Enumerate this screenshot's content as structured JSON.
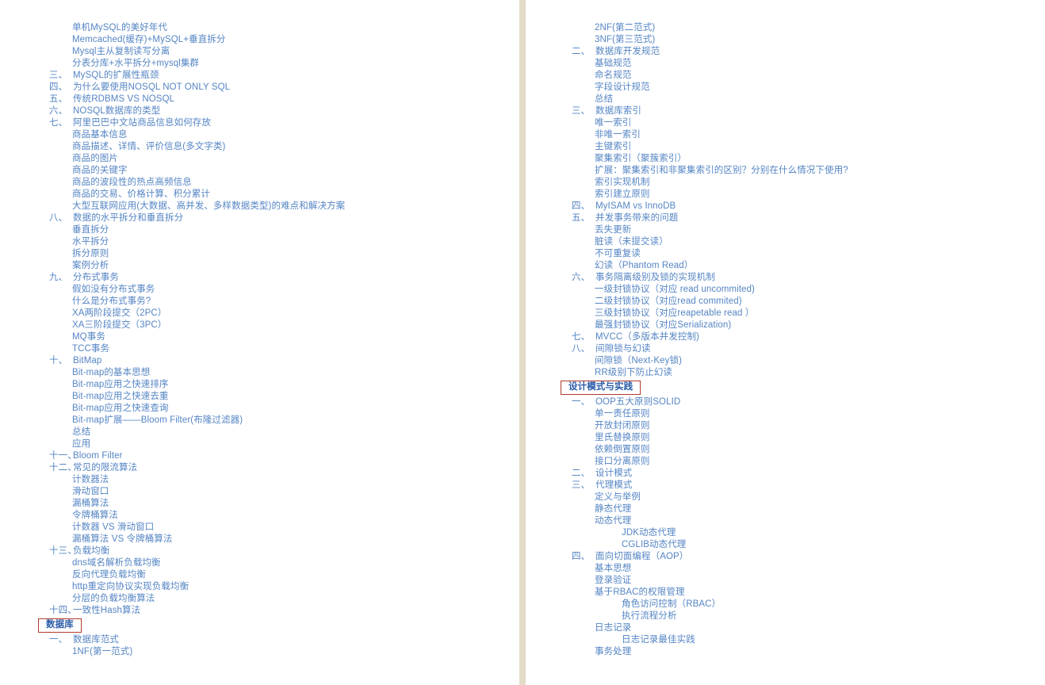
{
  "document": {
    "title": "技术知识体系目录",
    "text_color": "#5585c4",
    "section_box_border_color": "#b03a2e",
    "section_box_text_color": "#2a5ca8",
    "divider_color": "#e3dcc6"
  },
  "columns": [
    {
      "name": "left-column",
      "rows": [
        {
          "level": "sub1",
          "text": "单机MySQL的美好年代"
        },
        {
          "level": "sub1",
          "text": "Memcached(缓存)+MySQL+垂直拆分"
        },
        {
          "level": "sub1",
          "text": "Mysql主从复制读写分离"
        },
        {
          "level": "sub1",
          "text": "分表分库+水平拆分+mysql集群"
        },
        {
          "level": "num",
          "num": "三、",
          "text": "MySQL的扩展性瓶颈"
        },
        {
          "level": "num",
          "num": "四、",
          "text": "为什么要使用NOSQL NOT ONLY SQL"
        },
        {
          "level": "num",
          "num": "五、",
          "text": "传统RDBMS VS NOSQL"
        },
        {
          "level": "num",
          "num": "六、",
          "text": "NOSQL数据库的类型"
        },
        {
          "level": "num",
          "num": "七、",
          "text": "阿里巴巴中文站商品信息如何存放"
        },
        {
          "level": "sub1",
          "text": "商品基本信息"
        },
        {
          "level": "sub1",
          "text": "商品描述、详情、评价信息(多文字类)"
        },
        {
          "level": "sub1",
          "text": "商品的图片"
        },
        {
          "level": "sub1",
          "text": "商品的关键字"
        },
        {
          "level": "sub1",
          "text": "商品的波段性的热点高频信息"
        },
        {
          "level": "sub1",
          "text": "商品的交易、价格计算、积分累计"
        },
        {
          "level": "sub1",
          "text": "大型互联网应用(大数据、高并发、多样数据类型)的难点和解决方案"
        },
        {
          "level": "num",
          "num": "八、",
          "text": "数据的水平拆分和垂直拆分"
        },
        {
          "level": "sub1",
          "text": "垂直拆分"
        },
        {
          "level": "sub1",
          "text": "水平拆分"
        },
        {
          "level": "sub1",
          "text": "拆分原则"
        },
        {
          "level": "sub1",
          "text": "案例分析"
        },
        {
          "level": "num",
          "num": "九、",
          "text": "分布式事务"
        },
        {
          "level": "sub1",
          "text": "假如没有分布式事务"
        },
        {
          "level": "sub1",
          "text": "什么是分布式事务?"
        },
        {
          "level": "sub1",
          "text": "XA两阶段提交（2PC）"
        },
        {
          "level": "sub1",
          "text": "XA三阶段提交（3PC）"
        },
        {
          "level": "sub1",
          "text": "MQ事务"
        },
        {
          "level": "sub1",
          "text": "TCC事务"
        },
        {
          "level": "num",
          "num": "十、",
          "text": "BitMap"
        },
        {
          "level": "sub1",
          "text": "Bit-map的基本思想"
        },
        {
          "level": "sub1",
          "text": "Bit-map应用之快速排序"
        },
        {
          "level": "sub1",
          "text": "Bit-map应用之快速去重"
        },
        {
          "level": "sub1",
          "text": "Bit-map应用之快速查询"
        },
        {
          "level": "sub1",
          "text": "Bit-map扩展——Bloom Filter(布隆过滤器)"
        },
        {
          "level": "sub1",
          "text": "总结"
        },
        {
          "level": "sub1",
          "text": "应用"
        },
        {
          "level": "num",
          "num": "十一、",
          "text": "Bloom Filter"
        },
        {
          "level": "num",
          "num": "十二、",
          "text": "常见的限流算法"
        },
        {
          "level": "sub1",
          "text": "计数器法"
        },
        {
          "level": "sub1",
          "text": "滑动窗口"
        },
        {
          "level": "sub1",
          "text": "漏桶算法"
        },
        {
          "level": "sub1",
          "text": "令牌桶算法"
        },
        {
          "level": "sub1",
          "text": "计数器 VS 滑动窗口"
        },
        {
          "level": "sub1",
          "text": "漏桶算法 VS 令牌桶算法"
        },
        {
          "level": "num",
          "num": "十三、",
          "text": "负载均衡"
        },
        {
          "level": "sub1",
          "text": "dns域名解析负载均衡"
        },
        {
          "level": "sub1",
          "text": "反向代理负载均衡"
        },
        {
          "level": "sub1",
          "text": "http重定向协议实现负载均衡"
        },
        {
          "level": "sub1",
          "text": "分层的负载均衡算法"
        },
        {
          "level": "num",
          "num": "十四、",
          "text": "一致性Hash算法"
        },
        {
          "level": "section",
          "text": "数据库"
        },
        {
          "level": "num",
          "num": "一、",
          "text": "数据库范式"
        },
        {
          "level": "sub1",
          "text": "1NF(第一范式)"
        }
      ]
    },
    {
      "name": "right-column",
      "rows": [
        {
          "level": "sub1",
          "text": "2NF(第二范式)"
        },
        {
          "level": "sub1",
          "text": "3NF(第三范式)"
        },
        {
          "level": "num",
          "num": "二、",
          "text": "数据库开发规范"
        },
        {
          "level": "sub1",
          "text": "基础规范"
        },
        {
          "level": "sub1",
          "text": "命名规范"
        },
        {
          "level": "sub1",
          "text": "字段设计规范"
        },
        {
          "level": "sub1",
          "text": "总结"
        },
        {
          "level": "num",
          "num": "三、",
          "text": "数据库索引"
        },
        {
          "level": "sub1",
          "text": "唯一索引"
        },
        {
          "level": "sub1",
          "text": "非唯一索引"
        },
        {
          "level": "sub1",
          "text": "主键索引"
        },
        {
          "level": "sub1",
          "text": "聚集索引（聚簇索引）"
        },
        {
          "level": "sub1",
          "text": "扩展：聚集索引和非聚集索引的区别？分别在什么情况下使用?"
        },
        {
          "level": "sub1",
          "text": "索引实现机制"
        },
        {
          "level": "sub1",
          "text": "索引建立原则"
        },
        {
          "level": "num",
          "num": "四、",
          "text": "MyISAM vs InnoDB"
        },
        {
          "level": "num",
          "num": "五、",
          "text": "并发事务带来的问题"
        },
        {
          "level": "sub1",
          "text": "丢失更新"
        },
        {
          "level": "sub1",
          "text": "脏读（未提交读）"
        },
        {
          "level": "sub1",
          "text": "不可重复读"
        },
        {
          "level": "sub1",
          "text": "幻读（Phantom Read）"
        },
        {
          "level": "num",
          "num": "六、",
          "text": "事务隔离级别及锁的实现机制"
        },
        {
          "level": "sub1",
          "text": "一级封锁协议（对应 read uncommited)"
        },
        {
          "level": "sub1",
          "text": "二级封锁协议（对应read commited)"
        },
        {
          "level": "sub1",
          "text": "三级封锁协议（对应reapetable read ）"
        },
        {
          "level": "sub1",
          "text": "最强封锁协议（对应Serialization)"
        },
        {
          "level": "num",
          "num": "七、",
          "text": "MVCC（多版本并发控制)"
        },
        {
          "level": "num",
          "num": "八、",
          "text": "间隙锁与幻读"
        },
        {
          "level": "sub1",
          "text": "间隙锁（Next-Key锁)"
        },
        {
          "level": "sub1",
          "text": "RR级别下防止幻读"
        },
        {
          "level": "section",
          "text": "设计模式与实践"
        },
        {
          "level": "num",
          "num": "一、",
          "text": "OOP五大原则SOLID"
        },
        {
          "level": "sub1",
          "text": "单一责任原则"
        },
        {
          "level": "sub1",
          "text": "开放封闭原则"
        },
        {
          "level": "sub1",
          "text": "里氏替换原则"
        },
        {
          "level": "sub1",
          "text": "依赖倒置原则"
        },
        {
          "level": "sub1",
          "text": "接口分离原则"
        },
        {
          "level": "num",
          "num": "二、",
          "text": "设计模式"
        },
        {
          "level": "num",
          "num": "三、",
          "text": "代理模式"
        },
        {
          "level": "sub1",
          "text": "定义与举例"
        },
        {
          "level": "sub1",
          "text": "静态代理"
        },
        {
          "level": "sub1",
          "text": "动态代理"
        },
        {
          "level": "sub2",
          "text": "JDK动态代理"
        },
        {
          "level": "sub2",
          "text": "CGLIB动态代理"
        },
        {
          "level": "num",
          "num": "四、",
          "text": "面向切面编程（AOP）"
        },
        {
          "level": "sub1",
          "text": "基本思想"
        },
        {
          "level": "sub1",
          "text": "登录验证"
        },
        {
          "level": "sub1",
          "text": "基于RBAC的权限管理"
        },
        {
          "level": "sub2",
          "text": "角色访问控制（RBAC）"
        },
        {
          "level": "sub2",
          "text": "执行流程分析"
        },
        {
          "level": "sub1",
          "text": "日志记录"
        },
        {
          "level": "sub2",
          "text": "日志记录最佳实践"
        },
        {
          "level": "sub1",
          "text": "事务处理"
        }
      ]
    }
  ]
}
